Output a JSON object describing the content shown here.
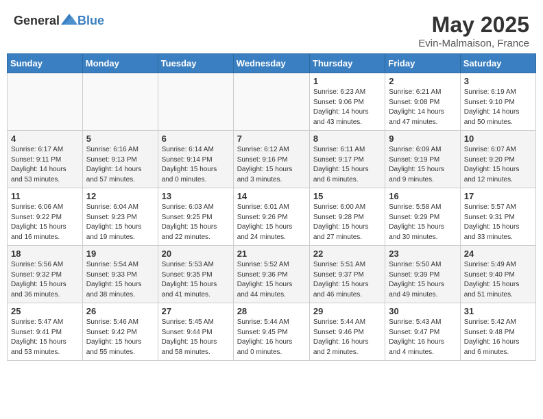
{
  "header": {
    "logo_general": "General",
    "logo_blue": "Blue",
    "title": "May 2025",
    "subtitle": "Evin-Malmaison, France"
  },
  "days_of_week": [
    "Sunday",
    "Monday",
    "Tuesday",
    "Wednesday",
    "Thursday",
    "Friday",
    "Saturday"
  ],
  "weeks": [
    [
      {
        "day": "",
        "info": ""
      },
      {
        "day": "",
        "info": ""
      },
      {
        "day": "",
        "info": ""
      },
      {
        "day": "",
        "info": ""
      },
      {
        "day": "1",
        "info": "Sunrise: 6:23 AM\nSunset: 9:06 PM\nDaylight: 14 hours\nand 43 minutes."
      },
      {
        "day": "2",
        "info": "Sunrise: 6:21 AM\nSunset: 9:08 PM\nDaylight: 14 hours\nand 47 minutes."
      },
      {
        "day": "3",
        "info": "Sunrise: 6:19 AM\nSunset: 9:10 PM\nDaylight: 14 hours\nand 50 minutes."
      }
    ],
    [
      {
        "day": "4",
        "info": "Sunrise: 6:17 AM\nSunset: 9:11 PM\nDaylight: 14 hours\nand 53 minutes."
      },
      {
        "day": "5",
        "info": "Sunrise: 6:16 AM\nSunset: 9:13 PM\nDaylight: 14 hours\nand 57 minutes."
      },
      {
        "day": "6",
        "info": "Sunrise: 6:14 AM\nSunset: 9:14 PM\nDaylight: 15 hours\nand 0 minutes."
      },
      {
        "day": "7",
        "info": "Sunrise: 6:12 AM\nSunset: 9:16 PM\nDaylight: 15 hours\nand 3 minutes."
      },
      {
        "day": "8",
        "info": "Sunrise: 6:11 AM\nSunset: 9:17 PM\nDaylight: 15 hours\nand 6 minutes."
      },
      {
        "day": "9",
        "info": "Sunrise: 6:09 AM\nSunset: 9:19 PM\nDaylight: 15 hours\nand 9 minutes."
      },
      {
        "day": "10",
        "info": "Sunrise: 6:07 AM\nSunset: 9:20 PM\nDaylight: 15 hours\nand 12 minutes."
      }
    ],
    [
      {
        "day": "11",
        "info": "Sunrise: 6:06 AM\nSunset: 9:22 PM\nDaylight: 15 hours\nand 16 minutes."
      },
      {
        "day": "12",
        "info": "Sunrise: 6:04 AM\nSunset: 9:23 PM\nDaylight: 15 hours\nand 19 minutes."
      },
      {
        "day": "13",
        "info": "Sunrise: 6:03 AM\nSunset: 9:25 PM\nDaylight: 15 hours\nand 22 minutes."
      },
      {
        "day": "14",
        "info": "Sunrise: 6:01 AM\nSunset: 9:26 PM\nDaylight: 15 hours\nand 24 minutes."
      },
      {
        "day": "15",
        "info": "Sunrise: 6:00 AM\nSunset: 9:28 PM\nDaylight: 15 hours\nand 27 minutes."
      },
      {
        "day": "16",
        "info": "Sunrise: 5:58 AM\nSunset: 9:29 PM\nDaylight: 15 hours\nand 30 minutes."
      },
      {
        "day": "17",
        "info": "Sunrise: 5:57 AM\nSunset: 9:31 PM\nDaylight: 15 hours\nand 33 minutes."
      }
    ],
    [
      {
        "day": "18",
        "info": "Sunrise: 5:56 AM\nSunset: 9:32 PM\nDaylight: 15 hours\nand 36 minutes."
      },
      {
        "day": "19",
        "info": "Sunrise: 5:54 AM\nSunset: 9:33 PM\nDaylight: 15 hours\nand 38 minutes."
      },
      {
        "day": "20",
        "info": "Sunrise: 5:53 AM\nSunset: 9:35 PM\nDaylight: 15 hours\nand 41 minutes."
      },
      {
        "day": "21",
        "info": "Sunrise: 5:52 AM\nSunset: 9:36 PM\nDaylight: 15 hours\nand 44 minutes."
      },
      {
        "day": "22",
        "info": "Sunrise: 5:51 AM\nSunset: 9:37 PM\nDaylight: 15 hours\nand 46 minutes."
      },
      {
        "day": "23",
        "info": "Sunrise: 5:50 AM\nSunset: 9:39 PM\nDaylight: 15 hours\nand 49 minutes."
      },
      {
        "day": "24",
        "info": "Sunrise: 5:49 AM\nSunset: 9:40 PM\nDaylight: 15 hours\nand 51 minutes."
      }
    ],
    [
      {
        "day": "25",
        "info": "Sunrise: 5:47 AM\nSunset: 9:41 PM\nDaylight: 15 hours\nand 53 minutes."
      },
      {
        "day": "26",
        "info": "Sunrise: 5:46 AM\nSunset: 9:42 PM\nDaylight: 15 hours\nand 55 minutes."
      },
      {
        "day": "27",
        "info": "Sunrise: 5:45 AM\nSunset: 9:44 PM\nDaylight: 15 hours\nand 58 minutes."
      },
      {
        "day": "28",
        "info": "Sunrise: 5:44 AM\nSunset: 9:45 PM\nDaylight: 16 hours\nand 0 minutes."
      },
      {
        "day": "29",
        "info": "Sunrise: 5:44 AM\nSunset: 9:46 PM\nDaylight: 16 hours\nand 2 minutes."
      },
      {
        "day": "30",
        "info": "Sunrise: 5:43 AM\nSunset: 9:47 PM\nDaylight: 16 hours\nand 4 minutes."
      },
      {
        "day": "31",
        "info": "Sunrise: 5:42 AM\nSunset: 9:48 PM\nDaylight: 16 hours\nand 6 minutes."
      }
    ]
  ]
}
